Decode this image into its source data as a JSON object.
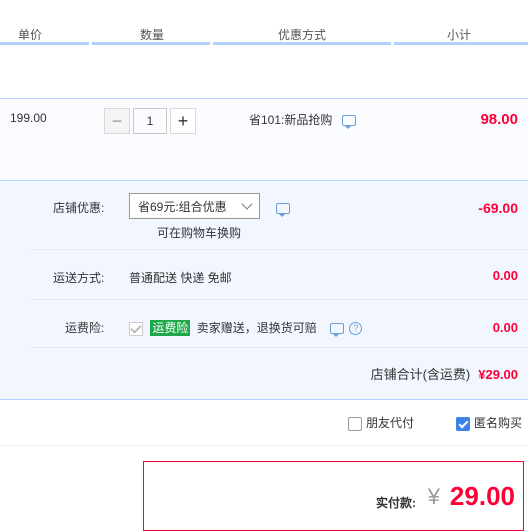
{
  "header": {
    "unit_price": "单价",
    "quantity": "数量",
    "discount_method": "优惠方式",
    "subtotal": "小计"
  },
  "item": {
    "price": "199.00",
    "quantity": "1",
    "minus": "−",
    "plus": "+",
    "promotion": "省101:新品抢购",
    "subtotal": "98.00"
  },
  "shop": {
    "discount_label": "店铺优惠:",
    "discount_select": "省69元:组合优惠",
    "discount_note": "可在购物车换购",
    "discount_amount": "-69.00",
    "shipping_label": "运送方式:",
    "shipping_value": "普通配送 快递 免邮",
    "shipping_amount": "0.00",
    "insurance_label": "运费险:",
    "insurance_tag": "运费险",
    "insurance_desc": "卖家赠送，退换货可赔",
    "insurance_amount": "0.00",
    "total_label": "店铺合计(含运费)",
    "total_amount": "¥29.00"
  },
  "options": {
    "friend_pay": "朋友代付",
    "anonymous": "匿名购买",
    "friend_pay_checked": false,
    "anonymous_checked": true
  },
  "payment": {
    "label": "实付款:",
    "currency": "¥",
    "amount": "29.00"
  },
  "colors": {
    "accent_red": "#ff0036",
    "accent_blue": "#3d82e6",
    "tag_green": "#1fa84b"
  }
}
